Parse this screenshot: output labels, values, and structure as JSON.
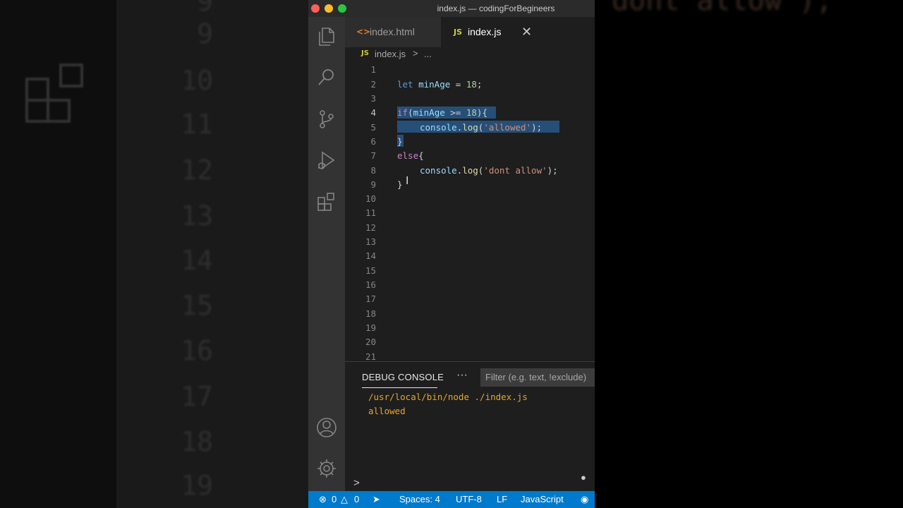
{
  "window": {
    "title": "index.js — codingForBegineers"
  },
  "tabs": [
    {
      "icon": "<>",
      "label": "index.html"
    },
    {
      "icon": "JS",
      "label": "index.js",
      "close": "✕"
    }
  ],
  "breadcrumb": {
    "icon": "JS",
    "file": "index.js",
    "separator": ">",
    "more": "..."
  },
  "editor": {
    "line_numbers": [
      "1",
      "2",
      "3",
      "4",
      "5",
      "6",
      "7",
      "8",
      "9",
      "10",
      "11",
      "12",
      "13",
      "14",
      "15",
      "16",
      "17",
      "18",
      "19",
      "20",
      "21"
    ],
    "active_line": "4",
    "lines": {
      "l2": {
        "kw": "let",
        "var": "minAge",
        "op": " = ",
        "num": "18",
        "end": ";"
      },
      "l4": {
        "kw": "if",
        "open": "(",
        "var": "minAge",
        "op": " >= ",
        "num": "18",
        "close": "){"
      },
      "l5": {
        "obj": "console",
        "dot": ".",
        "fn": "log",
        "open": "(",
        "str": "'allowed'",
        "close": ");"
      },
      "l6": {
        "text": "}"
      },
      "l7": {
        "kw": "else",
        "open": "{"
      },
      "l8": {
        "obj": "console",
        "dot": ".",
        "fn": "log",
        "open": "(",
        "str": "'dont allow'",
        "close": ");"
      },
      "l9": {
        "text": "}"
      }
    }
  },
  "panel": {
    "title": "DEBUG CONSOLE",
    "more": "···",
    "filter_placeholder": "Filter (e.g. text, !exclude)",
    "output": [
      "/usr/local/bin/node ./index.js",
      "allowed"
    ],
    "prompt": ">"
  },
  "status_bar": {
    "errors": "0",
    "warnings": "0",
    "spaces": "Spaces: 4",
    "encoding": "UTF-8",
    "eol": "LF",
    "language": "JavaScript"
  },
  "background": {
    "left_numbers": [
      "9",
      "10",
      "11",
      "12",
      "13",
      "14",
      "15",
      "16",
      "17",
      "18",
      "19"
    ],
    "right_text": "'dont allow');"
  },
  "colors": {
    "editor_bg": "#1e1e1e",
    "activity_bar": "#333333",
    "status_bar": "#007acc",
    "selection": "#264f78",
    "keyword": "#c586c0",
    "string": "#ce9178",
    "number": "#b5cea8",
    "debug_output": "#e2a82b"
  },
  "icons": [
    "explorer-icon",
    "search-icon",
    "source-control-icon",
    "run-debug-icon",
    "extensions-icon",
    "accounts-icon",
    "manage-gear-icon"
  ]
}
